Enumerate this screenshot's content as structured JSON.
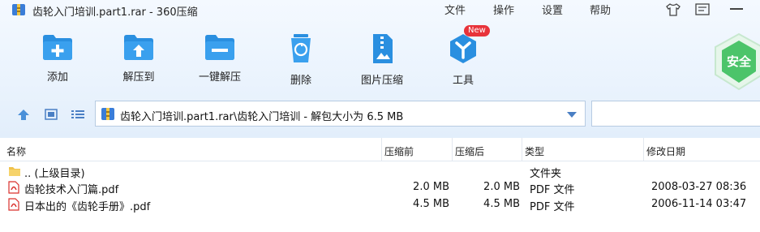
{
  "window": {
    "title": "齿轮入门培训.part1.rar - 360压缩",
    "menu": [
      "文件",
      "操作",
      "设置",
      "帮助"
    ]
  },
  "toolbar": {
    "add": "添加",
    "extract_to": "解压到",
    "one_key_extract": "一键解压",
    "delete": "删除",
    "image_compress": "图片压缩",
    "tools": "工具",
    "new_badge": "New"
  },
  "security_badge": "安全",
  "address": {
    "path": "齿轮入门培训.part1.rar\\齿轮入门培训 - 解包大小为 6.5 MB"
  },
  "columns": {
    "name": "名称",
    "size_before": "压缩前",
    "size_after": "压缩后",
    "type": "类型",
    "modified": "修改日期"
  },
  "files": [
    {
      "name": ".. (上级目录)",
      "size_before": "",
      "size_after": "",
      "type": "文件夹",
      "modified": "",
      "icon": "folder-icon"
    },
    {
      "name": "齿轮技术入门篇.pdf",
      "size_before": "2.0 MB",
      "size_after": "2.0 MB",
      "type": "PDF 文件",
      "modified": "2008-03-27 08:36",
      "icon": "pdf-icon"
    },
    {
      "name": "日本出的《齿轮手册》.pdf",
      "size_before": "4.5 MB",
      "size_after": "4.5 MB",
      "type": "PDF 文件",
      "modified": "2006-11-14 03:47",
      "icon": "pdf-icon"
    }
  ],
  "colors": {
    "accent_blue": "#2a8fe0",
    "badge_red": "#e8333a",
    "shield_green": "#4cc46a",
    "pdf_red": "#d9302c",
    "folder_yellow": "#f0c24b"
  }
}
